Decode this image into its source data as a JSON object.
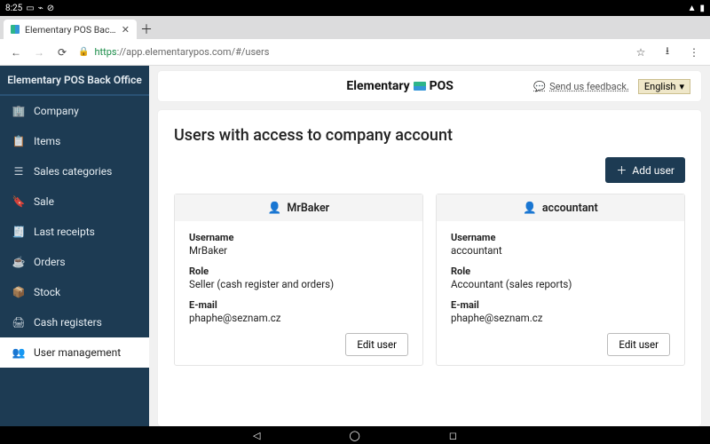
{
  "statusbar": {
    "time": "8:25"
  },
  "browser": {
    "tab_title": "Elementary POS Back office",
    "url_proto": "https",
    "url_rest": "://app.elementarypos.com/#/users"
  },
  "sidebar": {
    "header": "Elementary POS Back Office",
    "items": [
      {
        "label": "Company"
      },
      {
        "label": "Items"
      },
      {
        "label": "Sales categories"
      },
      {
        "label": "Sale"
      },
      {
        "label": "Last receipts"
      },
      {
        "label": "Orders"
      },
      {
        "label": "Stock"
      },
      {
        "label": "Cash registers"
      },
      {
        "label": "User management"
      }
    ]
  },
  "topbar": {
    "brand_a": "Elementary",
    "brand_b": "POS",
    "feedback": "Send us feedback.",
    "language": "English"
  },
  "page": {
    "title": "Users with access to company account",
    "add_user": "Add user",
    "edit_user": "Edit user",
    "labels": {
      "username": "Username",
      "role": "Role",
      "email": "E-mail"
    }
  },
  "users": [
    {
      "display": "MrBaker",
      "username": "MrBaker",
      "role": "Seller (cash register and orders)",
      "email": "phaphe@seznam.cz"
    },
    {
      "display": "accountant",
      "username": "accountant",
      "role": "Accountant (sales reports)",
      "email": "phaphe@seznam.cz"
    }
  ]
}
